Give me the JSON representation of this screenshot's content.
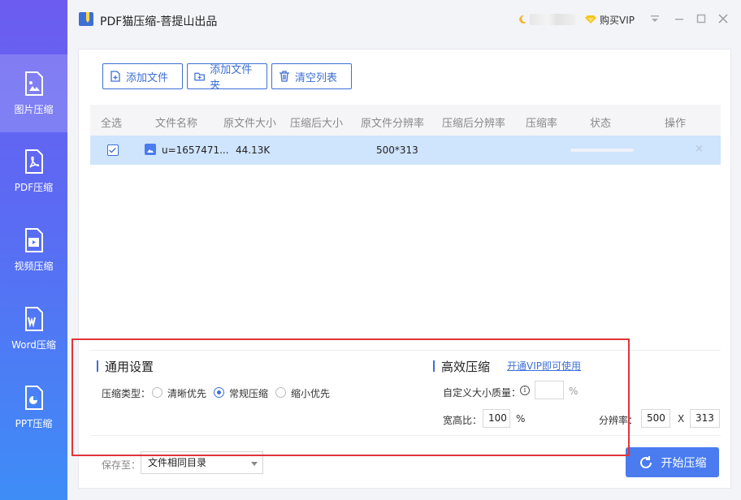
{
  "app": {
    "title": "PDF猫压缩-菩提山出品",
    "vip_label": "购买VIP"
  },
  "sidebar": {
    "items": [
      {
        "label": "图片压缩"
      },
      {
        "label": "PDF压缩"
      },
      {
        "label": "视频压缩"
      },
      {
        "label": "Word压缩"
      },
      {
        "label": "PPT压缩"
      }
    ]
  },
  "toolbar": {
    "add_file": "添加文件",
    "add_folder": "添加文件夹",
    "clear_list": "清空列表"
  },
  "table": {
    "headers": {
      "select_all": "全选",
      "name": "文件名称",
      "orig_size": "原文件大小",
      "new_size": "压缩后大小",
      "orig_res": "原文件分辨率",
      "new_res": "压缩后分辨率",
      "ratio": "压缩率",
      "status": "状态",
      "action": "操作"
    },
    "rows": [
      {
        "name": "u=1657471...",
        "orig_size": "44.13K",
        "orig_res": "500*313",
        "progress": 0.0,
        "remove": "×"
      }
    ]
  },
  "general": {
    "title": "通用设置",
    "type_label": "压缩类型：",
    "options": [
      "清晰优先",
      "常规压缩",
      "缩小优先"
    ],
    "selected": "常规压缩"
  },
  "advanced": {
    "title": "高效压缩",
    "vip_link": "开通VIP即可使用",
    "quality_label": "自定义大小质量：",
    "quality_value": "",
    "quality_unit": "%",
    "aspect_label": "宽高比：",
    "aspect_value": "100",
    "aspect_unit": "%",
    "res_label": "分辨率：",
    "res_width": "500",
    "res_x": "X",
    "res_height": "313"
  },
  "footer": {
    "save_label": "保存至：",
    "save_target": "文件相同目录",
    "start_label": "开始压缩"
  },
  "colors": {
    "accent": "#3d6fd6",
    "button": "#4a7cf0",
    "row_highlight": "#cfe4fd",
    "annotation": "#e0353a"
  }
}
